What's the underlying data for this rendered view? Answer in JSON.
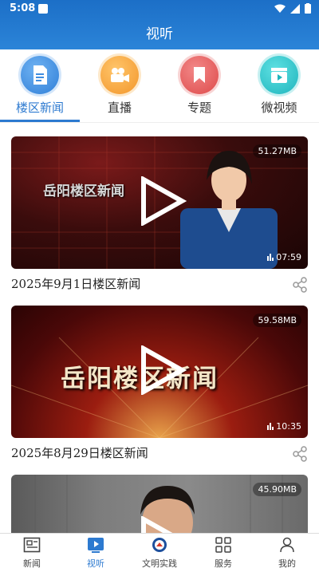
{
  "status_bar": {
    "time": "5:08"
  },
  "header": {
    "title": "视听"
  },
  "top_nav": [
    {
      "label": "楼区新闻",
      "icon": "document-icon",
      "color": "#3e8de0",
      "active": true
    },
    {
      "label": "直播",
      "icon": "video-camera-icon",
      "color": "#f5a33a",
      "active": false
    },
    {
      "label": "专题",
      "icon": "bookmark-icon",
      "color": "#e55a5a",
      "active": false
    },
    {
      "label": "微视频",
      "icon": "clapperboard-icon",
      "color": "#2cc4c9",
      "active": false
    }
  ],
  "videos": [
    {
      "title": "2025年9月1日楼区新闻",
      "size": "51.27MB",
      "duration": "07:59",
      "overlay_text": "岳阳楼区新闻"
    },
    {
      "title": "2025年8月29日楼区新闻",
      "size": "59.58MB",
      "duration": "10:35",
      "overlay_text": "岳阳楼区新闻"
    },
    {
      "title": "",
      "size": "45.90MB",
      "duration": ""
    }
  ],
  "bottom_nav": [
    {
      "label": "新闻",
      "icon": "newspaper-icon",
      "active": false
    },
    {
      "label": "视听",
      "icon": "play-tv-icon",
      "active": true
    },
    {
      "label": "文明实践",
      "icon": "civilization-badge-icon",
      "active": false
    },
    {
      "label": "服务",
      "icon": "grid-icon",
      "active": false
    },
    {
      "label": "我的",
      "icon": "person-icon",
      "active": false
    }
  ],
  "colors": {
    "header": "#2079d0",
    "accent": "#2d7ad0"
  }
}
